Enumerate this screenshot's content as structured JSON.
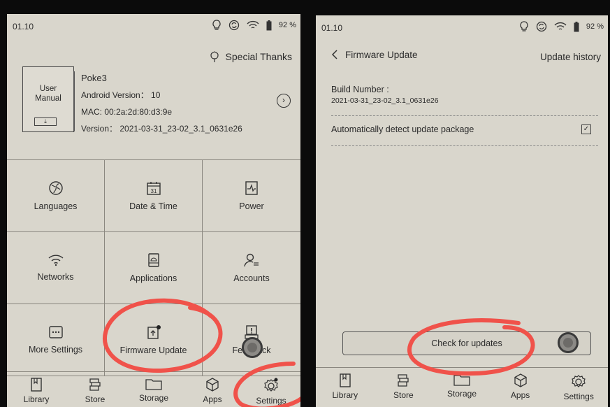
{
  "left_screen": {
    "status": {
      "time": "01.10",
      "battery": "92 %"
    },
    "special_thanks": "Special Thanks",
    "user_manual": {
      "line1": "User",
      "line2": "Manual",
      "download": "⤓"
    },
    "device": {
      "name": "Poke3",
      "android": "Android Version： 10",
      "mac": "MAC: 00:2a:2d:80:d3:9e",
      "version": "Version： 2021-03-31_23-02_3.1_0631e26"
    },
    "grid": [
      {
        "label": "Languages",
        "icon": "globe-icon"
      },
      {
        "label": "Date & Time",
        "icon": "calendar-icon",
        "day": "31"
      },
      {
        "label": "Power",
        "icon": "power-icon"
      },
      {
        "label": "Networks",
        "icon": "wifi-icon"
      },
      {
        "label": "Applications",
        "icon": "android-app-icon"
      },
      {
        "label": "Accounts",
        "icon": "account-icon"
      },
      {
        "label": "More Settings",
        "icon": "more-icon"
      },
      {
        "label": "Firmware Update",
        "icon": "firmware-icon"
      },
      {
        "label": "Feedback",
        "icon": "feedback-icon"
      }
    ],
    "tabs": [
      {
        "label": "Library",
        "icon": "library-icon"
      },
      {
        "label": "Store",
        "icon": "store-icon"
      },
      {
        "label": "Storage",
        "icon": "storage-icon"
      },
      {
        "label": "Apps",
        "icon": "apps-icon"
      },
      {
        "label": "Settings",
        "icon": "settings-icon"
      }
    ]
  },
  "right_screen": {
    "status": {
      "time": "01.10",
      "battery": "92 %"
    },
    "title": "Firmware Update",
    "update_history": "Update history",
    "build_label": "Build Number :",
    "build_number": "2021-03-31_23-02_3.1_0631e26",
    "auto_detect": "Automatically detect update package",
    "auto_detect_checked": true,
    "check_button": "Check for updates",
    "tabs": [
      {
        "label": "Library",
        "icon": "library-icon"
      },
      {
        "label": "Store",
        "icon": "store-icon"
      },
      {
        "label": "Storage",
        "icon": "storage-icon"
      },
      {
        "label": "Apps",
        "icon": "apps-icon"
      },
      {
        "label": "Settings",
        "icon": "settings-icon"
      }
    ]
  },
  "colors": {
    "screen": "#d9d6cc",
    "annotation": "#f0524a",
    "ink": "#2b2b2b"
  }
}
